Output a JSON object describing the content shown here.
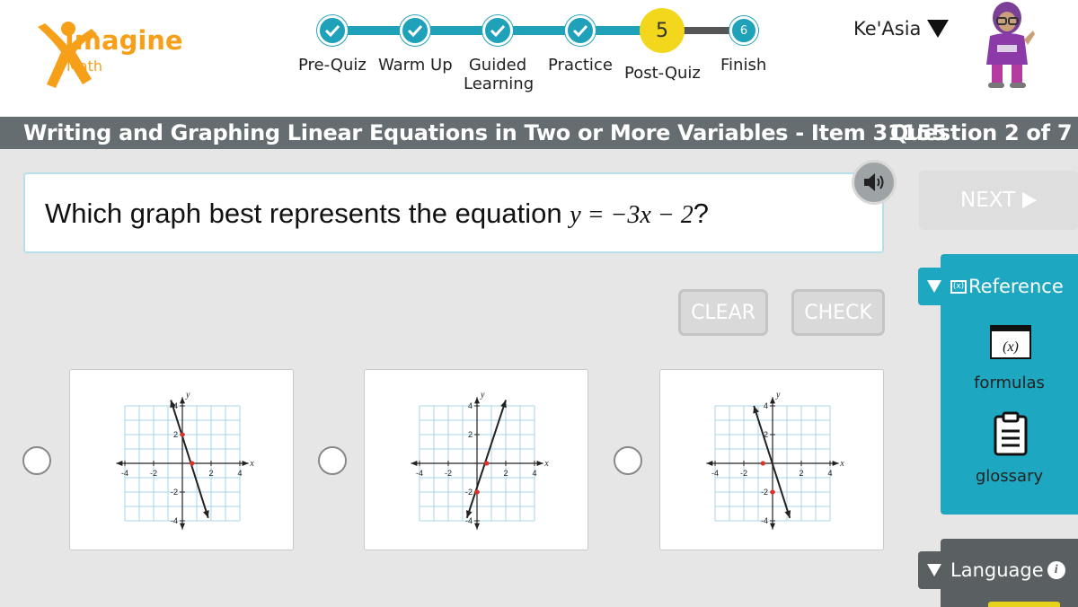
{
  "app": {
    "logo_name": "Imagine",
    "logo_sub": "Math",
    "brand_color": "#f6a01a",
    "accent_color": "#1ea1b9"
  },
  "progress": {
    "steps": [
      {
        "label": "Pre-Quiz",
        "state": "done",
        "icon": "check-icon"
      },
      {
        "label": "Warm Up",
        "state": "done",
        "icon": "check-icon"
      },
      {
        "label": "Guided Learning",
        "state": "done",
        "icon": "check-icon"
      },
      {
        "label": "Practice",
        "state": "done",
        "icon": "check-icon"
      },
      {
        "label": "Post-Quiz",
        "state": "current",
        "number": "5"
      },
      {
        "label": "Finish",
        "state": "future",
        "number": "6"
      }
    ]
  },
  "user": {
    "name": "Ke'Asia"
  },
  "title_bar": {
    "lesson": "Writing and Graphing Linear Equations in Two or More Variables - Item 31155",
    "question_counter": "Question 2 of 7"
  },
  "question": {
    "prompt": "Which graph best represents the equation",
    "equation": "y = −3x − 2",
    "end": "?"
  },
  "buttons": {
    "next": "NEXT",
    "clear": "CLEAR",
    "check": "CHECK"
  },
  "choices": [
    {
      "line": {
        "x1": -0.8,
        "y1": 4.4,
        "x2": 1.8,
        "y2": -3.8
      },
      "points": [
        [
          0,
          2
        ],
        [
          0.67,
          0
        ]
      ]
    },
    {
      "line": {
        "x1": -0.7,
        "y1": -3.8,
        "x2": 2.0,
        "y2": 4.4
      },
      "points": [
        [
          0,
          -2
        ],
        [
          0.67,
          0
        ]
      ]
    },
    {
      "line": {
        "x1": -1.3,
        "y1": 4.0,
        "x2": 1.2,
        "y2": -3.8
      },
      "points": [
        [
          -0.67,
          0
        ],
        [
          0,
          -2
        ]
      ]
    }
  ],
  "graph_axes": {
    "x_ticks": [
      "-4",
      "-2",
      "2",
      "4"
    ],
    "y_ticks": [
      "4",
      "2",
      "-2",
      "-4"
    ],
    "x_label": "x",
    "y_label": "y"
  },
  "reference": {
    "tab_label": "Reference",
    "items": [
      {
        "label": "formulas",
        "icon": "formula-icon",
        "glyph": "(x)"
      },
      {
        "label": "glossary",
        "icon": "clipboard-icon"
      }
    ]
  },
  "language": {
    "tab_label": "Language",
    "info_glyph": "i"
  }
}
